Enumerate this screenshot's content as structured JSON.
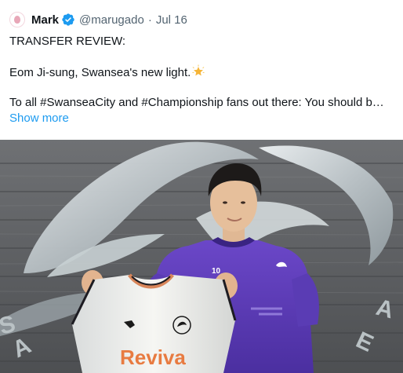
{
  "tweet": {
    "author_name": "Mark",
    "handle": "@marugado",
    "separator": "·",
    "date": "Jul 16",
    "lines": [
      "TRANSFER REVIEW:",
      "Eom Ji-sung, Swansea's new light.",
      "To all #SwanseaCity and #Championship fans out there: You should b…"
    ],
    "show_more": "Show more",
    "icons": {
      "avatar": "avatar-icon",
      "verified": "verified-badge-icon",
      "star": "glowing-star-emoji"
    },
    "colors": {
      "link": "#1d9bf0",
      "secondary": "#536471",
      "verified": "#1d9bf0"
    }
  },
  "media": {
    "alt": "Player holding Swansea jersey",
    "shirt_sponsor": "Reviva",
    "shirt_number": "10"
  }
}
